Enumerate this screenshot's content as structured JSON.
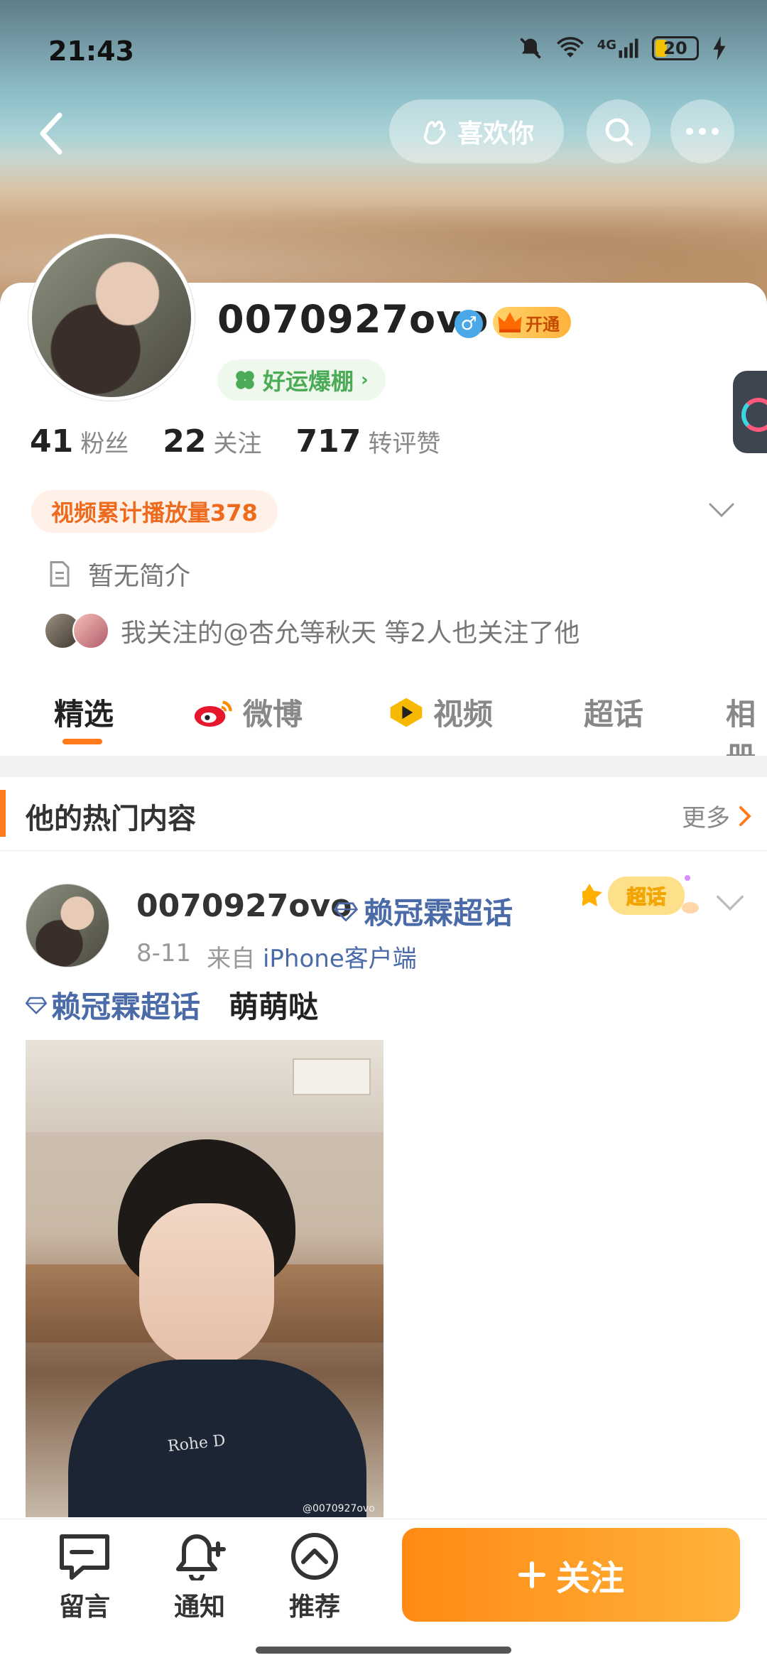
{
  "status_bar": {
    "time": "21:43",
    "network": "4G",
    "battery": "20"
  },
  "top_nav": {
    "like_label": "喜欢你"
  },
  "profile": {
    "username": "0070927ovo",
    "gender_symbol": "♂",
    "vip_label": "开通",
    "luck_label": "好运爆棚",
    "stats": [
      {
        "num": "41",
        "label": "粉丝"
      },
      {
        "num": "22",
        "label": "关注"
      },
      {
        "num": "717",
        "label": "转评赞"
      }
    ],
    "video_play_label": "视频累计播放量378",
    "intro": "暂无简介",
    "mutual": "我关注的@杏允等秋天 等2人也关注了他"
  },
  "tabs": [
    {
      "label": "精选",
      "icon": ""
    },
    {
      "label": "微博",
      "icon": "weibo-icon"
    },
    {
      "label": "视频",
      "icon": "video-icon"
    },
    {
      "label": "超话",
      "icon": ""
    },
    {
      "label": "相册",
      "icon": ""
    }
  ],
  "hot_section": {
    "title": "他的热门内容",
    "more": "更多"
  },
  "post": {
    "username": "0070927ovo",
    "topic": "赖冠霖超话",
    "date": "8-11",
    "from_label": "来自",
    "client": "iPhone客户端",
    "sticker": "超话",
    "topic_link": "赖冠霖超话",
    "content": "萌萌哒",
    "photo_shirt_text": "Rohe D",
    "photo_watermark": "@0070927ovo"
  },
  "bottom_bar": {
    "items": [
      {
        "label": "留言",
        "icon": "message-icon"
      },
      {
        "label": "通知",
        "icon": "bell-plus-icon"
      },
      {
        "label": "推荐",
        "icon": "up-circle-icon"
      }
    ],
    "follow_label": "关注"
  },
  "colors": {
    "accent": "#ff7a1a",
    "link": "#4b6aa8",
    "luck": "#4bab57"
  }
}
